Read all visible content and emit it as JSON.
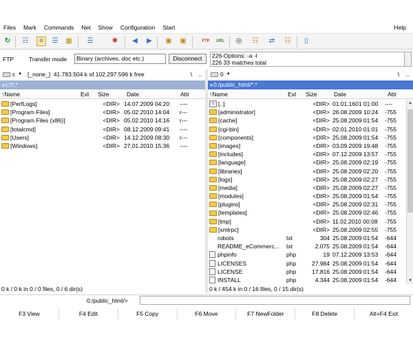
{
  "menu": [
    "Files",
    "Mark",
    "Commands",
    "Net",
    "Show",
    "Configuration",
    "Start"
  ],
  "help_label": "Help",
  "toolbar_icons": [
    "refresh-icon",
    "brief-view-icon",
    "full-view-icon",
    "tree-view-icon",
    "thumbnails-icon",
    "invert-selection-icon",
    "back-icon",
    "forward-icon",
    "pack-icon",
    "unpack-icon",
    "ftp-connect-icon",
    "url-connect-icon",
    "find-icon",
    "multi-rename-icon",
    "sync-dirs-icon",
    "notepad-icon"
  ],
  "ftp": {
    "label": "FTP",
    "transfer_mode_label": "Transfer mode",
    "transfer_mode_value": "Binary (archives, doc etc.)",
    "disconnect_label": "Disconnect",
    "log_lines": [
      "226-Options: -a -l",
      "226 33 matches total"
    ]
  },
  "left": {
    "drive_letter": "c",
    "drive_label": "[_none_]",
    "free_space": "41.783.504 k of 102.297.596 k free",
    "root_button": "\\",
    "up_button": "..",
    "path": "c:\\*.*",
    "headers": {
      "name": "↑Name",
      "ext": "Ext",
      "size": "Size",
      "date": "Date",
      "attr": "Attr"
    },
    "files": [
      {
        "name": "[PerfLogs]",
        "ext": "",
        "size": "<DIR>",
        "date": "14.07.2009 04:20",
        "attr": "----"
      },
      {
        "name": "[Program Files]",
        "ext": "",
        "size": "<DIR>",
        "date": "05.02.2010 14:04",
        "attr": "r---"
      },
      {
        "name": "[Program Files (x86)]",
        "ext": "",
        "size": "<DIR>",
        "date": "05.02.2010 14:16",
        "attr": "r---"
      },
      {
        "name": "[totalcmd]",
        "ext": "",
        "size": "<DIR>",
        "date": "08.12.2009 09:41",
        "attr": "----"
      },
      {
        "name": "[Users]",
        "ext": "",
        "size": "<DIR>",
        "date": "14.12.2009 08:30",
        "attr": "r---"
      },
      {
        "name": "[Windows]",
        "ext": "",
        "size": "<DIR>",
        "date": "27.01.2010 15:36",
        "attr": "----"
      }
    ],
    "status": "0 k / 0 k in 0 / 0 files, 0 / 6 dir(s)"
  },
  "right": {
    "drive_letter": "0",
    "root_button": "\\",
    "up_button": "..",
    "path": "0:/public_html/*.*",
    "headers": {
      "name": "↑Name",
      "ext": "Ext",
      "size": "Size",
      "date": "Date",
      "attr": "Attr"
    },
    "files": [
      {
        "name": "[..]",
        "ext": "",
        "size": "<DIR>",
        "date": "01.01.1601 01:00",
        "attr": "----",
        "type": "up"
      },
      {
        "name": "[administrator]",
        "ext": "",
        "size": "<DIR>",
        "date": "26.08.2009 10:24",
        "attr": "-755",
        "type": "dir"
      },
      {
        "name": "[cache]",
        "ext": "",
        "size": "<DIR>",
        "date": "25.08.2009 01:54",
        "attr": "-755",
        "type": "dir"
      },
      {
        "name": "[cgi-bin]",
        "ext": "",
        "size": "<DIR>",
        "date": "02.01.2010 01:01",
        "attr": "-755",
        "type": "dir"
      },
      {
        "name": "[components]",
        "ext": "",
        "size": "<DIR>",
        "date": "25.08.2009 01:54",
        "attr": "-755",
        "type": "dir"
      },
      {
        "name": "[images]",
        "ext": "",
        "size": "<DIR>",
        "date": "03.09.2009 19:48",
        "attr": "-755",
        "type": "dir"
      },
      {
        "name": "[includes]",
        "ext": "",
        "size": "<DIR>",
        "date": "07.12.2009 13:57",
        "attr": "-755",
        "type": "dir"
      },
      {
        "name": "[language]",
        "ext": "",
        "size": "<DIR>",
        "date": "25.08.2009 02:19",
        "attr": "-755",
        "type": "dir"
      },
      {
        "name": "[libraries]",
        "ext": "",
        "size": "<DIR>",
        "date": "25.08.2009 02:20",
        "attr": "-755",
        "type": "dir"
      },
      {
        "name": "[logs]",
        "ext": "",
        "size": "<DIR>",
        "date": "25.08.2009 02:27",
        "attr": "-755",
        "type": "dir"
      },
      {
        "name": "[media]",
        "ext": "",
        "size": "<DIR>",
        "date": "25.08.2009 02:27",
        "attr": "-755",
        "type": "dir"
      },
      {
        "name": "[modules]",
        "ext": "",
        "size": "<DIR>",
        "date": "25.08.2009 01:54",
        "attr": "-755",
        "type": "dir"
      },
      {
        "name": "[plugins]",
        "ext": "",
        "size": "<DIR>",
        "date": "25.08.2009 02:31",
        "attr": "-755",
        "type": "dir"
      },
      {
        "name": "[templates]",
        "ext": "",
        "size": "<DIR>",
        "date": "25.08.2009 02:46",
        "attr": "-755",
        "type": "dir"
      },
      {
        "name": "[tmp]",
        "ext": "",
        "size": "<DIR>",
        "date": "11.02.2010 00:08",
        "attr": "-755",
        "type": "dir"
      },
      {
        "name": "[xmlrpc]",
        "ext": "",
        "size": "<DIR>",
        "date": "25.08.2009 02:55",
        "attr": "-755",
        "type": "dir"
      },
      {
        "name": "robots",
        "ext": "txt",
        "size": "304",
        "date": "25.08.2009 01:54",
        "attr": "-644",
        "type": "blank"
      },
      {
        "name": "README_eCommerc...",
        "ext": "txt",
        "size": "2.075",
        "date": "25.08.2009 01:54",
        "attr": "-644",
        "type": "blank"
      },
      {
        "name": "phpinfo",
        "ext": "php",
        "size": "19",
        "date": "07.12.2009 13:53",
        "attr": "-644",
        "type": "file"
      },
      {
        "name": "LICENSES",
        "ext": "php",
        "size": "27.984",
        "date": "25.08.2009 01:54",
        "attr": "-644",
        "type": "file"
      },
      {
        "name": "LICENSE",
        "ext": "php",
        "size": "17.816",
        "date": "25.08.2009 01:54",
        "attr": "-644",
        "type": "file"
      },
      {
        "name": "INSTALL",
        "ext": "php",
        "size": "4.344",
        "date": "25.08.2009 01:54",
        "attr": "-644",
        "type": "file"
      }
    ],
    "status": "0 k / 454 k in 0 / 16 files, 0 / 15 dir(s)"
  },
  "command_line": {
    "path": "0:/public_html/>",
    "value": ""
  },
  "fkeys": [
    "F3 View",
    "F4 Edit",
    "F5 Copy",
    "F6 Move",
    "F7 NewFolder",
    "F8 Delete",
    "Alt+F4 Exit"
  ]
}
